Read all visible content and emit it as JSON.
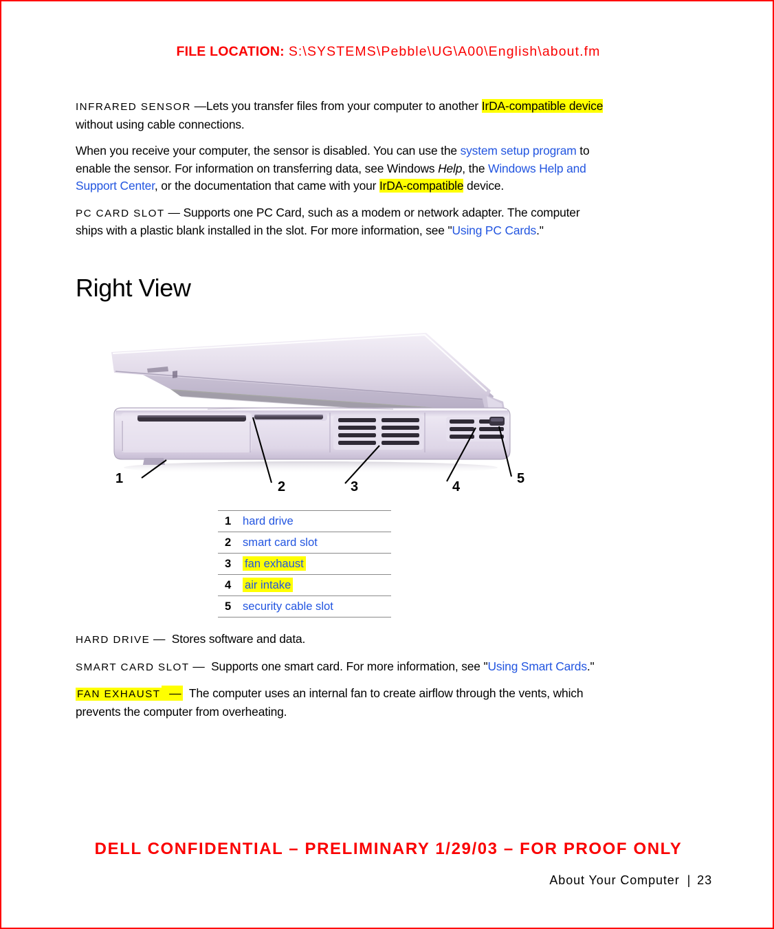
{
  "header": {
    "file_location_label": "FILE LOCATION:",
    "file_location_path": "S:\\SYSTEMS\\Pebble\\UG\\A00\\English\\about.fm"
  },
  "colors": {
    "frame_red": "#ff0000",
    "header_red": "#fa0000",
    "link_blue": "#2255e0",
    "highlight_yellow": "#ffff00",
    "rule_gray": "#8a8a8a",
    "text_black": "#000000"
  },
  "definitions_top": [
    {
      "term": "INFRARED SENSOR",
      "dash": "—",
      "text_1": "Lets you transfer files from your computer to another ",
      "highlight_1": "IrDA-compatible device",
      "text_2": " without using cable connections."
    }
  ],
  "paragraph_sensor": {
    "t1": "When you receive your computer, the sensor is disabled. You can use the ",
    "link1": "system setup program",
    "t2": " to enable the sensor. For information on transferring data, see Windows ",
    "italic1": "Help",
    "t3": ", the ",
    "link2": "Windows Help and Support Center",
    "t4": ", or the documentation that came with your ",
    "highlight1": "IrDA-compatible",
    "t5": " device."
  },
  "definition_pc_card": {
    "term": "PC CARD SLOT",
    "dash": "—",
    "t1": "Supports one PC Card, such as a modem or network adapter. The computer ships with a plastic blank installed in the slot. For more information, see \"",
    "link1": "Using PC Cards",
    "t2": ".\""
  },
  "section": {
    "heading": "Right View"
  },
  "figure": {
    "alt": "Right side view of a notebook computer with five numbered callouts",
    "callouts": [
      "1",
      "2",
      "3",
      "4",
      "5"
    ]
  },
  "legend": {
    "rows": [
      {
        "num": "1",
        "label": "hard drive",
        "highlighted": false
      },
      {
        "num": "2",
        "label": "smart card slot",
        "highlighted": false
      },
      {
        "num": "3",
        "label": "fan exhaust",
        "highlighted": true
      },
      {
        "num": "4",
        "label": "air intake",
        "highlighted": true
      },
      {
        "num": "5",
        "label": "security cable slot",
        "highlighted": false
      }
    ]
  },
  "definitions_bottom": {
    "hard_drive": {
      "term": "HARD DRIVE",
      "dash": "—",
      "text": "Stores software and data."
    },
    "smart_card_slot": {
      "term": "SMART CARD SLOT",
      "dash": "—",
      "t1": "Supports one smart card. For more information, see \"",
      "link1": "Using Smart Cards",
      "t2": ".\""
    },
    "fan_exhaust": {
      "term": "FAN EXHAUST",
      "dash": "—",
      "text": "The computer uses an internal fan to create airflow through the vents, which prevents the computer from overheating."
    }
  },
  "footer": {
    "confidential": "DELL CONFIDENTIAL – PRELIMINARY 1/29/03 – FOR PROOF ONLY",
    "chapter": "About Your Computer",
    "separator": "|",
    "page_number": "23"
  }
}
